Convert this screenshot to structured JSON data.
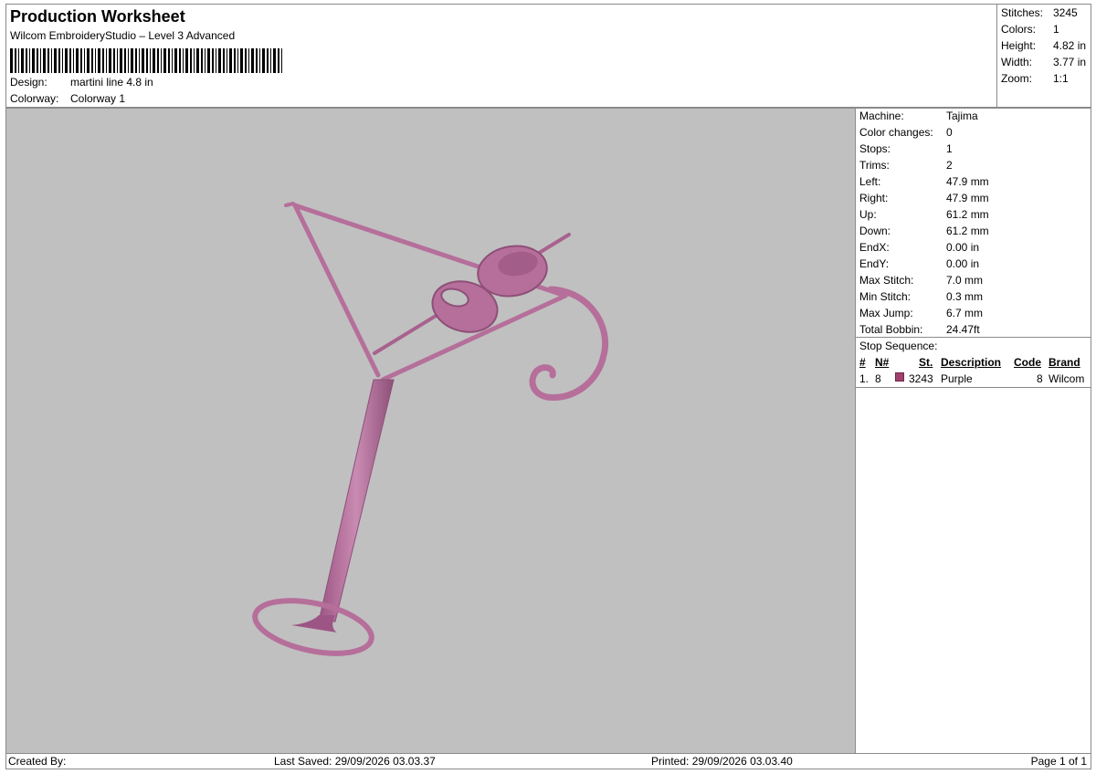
{
  "header": {
    "title": "Production Worksheet",
    "subtitle": "Wilcom EmbroideryStudio – Level 3 Advanced",
    "design_label": "Design:",
    "design_value": "martini line 4.8 in",
    "colorway_label": "Colorway:",
    "colorway_value": "Colorway 1"
  },
  "summary": {
    "stitches_label": "Stitches:",
    "stitches_value": "3245",
    "colors_label": "Colors:",
    "colors_value": "1",
    "height_label": "Height:",
    "height_value": "4.82 in",
    "width_label": "Width:",
    "width_value": "3.77 in",
    "zoom_label": "Zoom:",
    "zoom_value": "1:1"
  },
  "machine_info": {
    "rows": [
      {
        "label": "Machine:",
        "value": "Tajima"
      },
      {
        "label": "Color changes:",
        "value": "0"
      },
      {
        "label": "Stops:",
        "value": "1"
      },
      {
        "label": "Trims:",
        "value": "2"
      },
      {
        "label": "Left:",
        "value": "47.9 mm"
      },
      {
        "label": "Right:",
        "value": "47.9 mm"
      },
      {
        "label": "Up:",
        "value": "61.2 mm"
      },
      {
        "label": "Down:",
        "value": "61.2 mm"
      },
      {
        "label": "EndX:",
        "value": "0.00 in"
      },
      {
        "label": "EndY:",
        "value": "0.00 in"
      },
      {
        "label": "Max Stitch:",
        "value": "7.0 mm"
      },
      {
        "label": "Min Stitch:",
        "value": "0.3 mm"
      },
      {
        "label": "Max Jump:",
        "value": "6.7 mm"
      },
      {
        "label": "Total Bobbin:",
        "value": "24.47ft"
      }
    ]
  },
  "stop_sequence": {
    "title": "Stop Sequence:",
    "columns": {
      "num": "#",
      "needle": "N#",
      "stitches": "St.",
      "description": "Description",
      "code": "Code",
      "brand": "Brand"
    },
    "rows": [
      {
        "num": "1.",
        "needle": "8",
        "stitches": "3243",
        "description": "Purple",
        "code": "8",
        "brand": "Wilcom",
        "color": "#a0406e"
      }
    ]
  },
  "footer": {
    "created_by": "Created By:",
    "last_saved": "Last Saved: 29/09/2026 03.03.37",
    "printed": "Printed: 29/09/2026 03.03.40",
    "page": "Page 1 of 1"
  },
  "design_preview": {
    "thread_color": "#c07aa6",
    "thread_shadow": "#8e4f78",
    "background": "#c0c0c0"
  }
}
